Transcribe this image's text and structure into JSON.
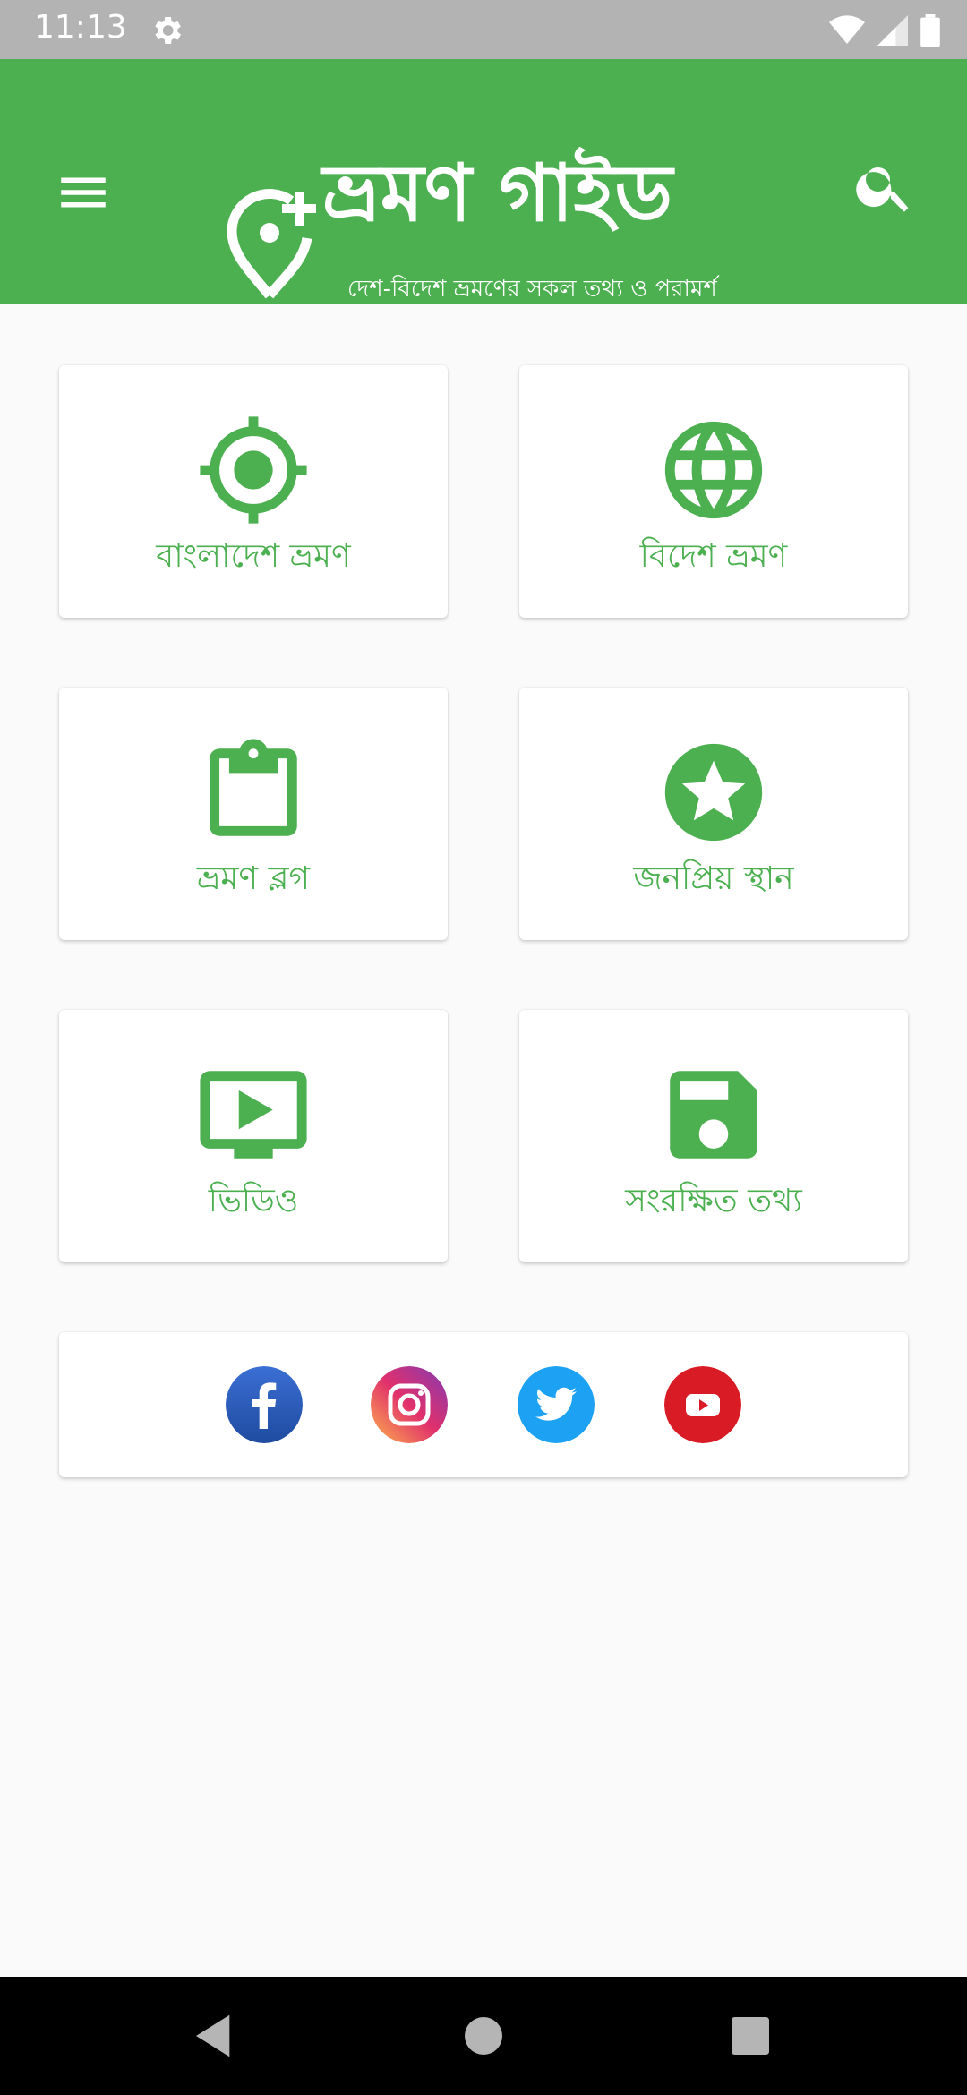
{
  "status_bar": {
    "time": "11:13",
    "icons": [
      "settings-icon",
      "wifi-icon",
      "signal-icon",
      "battery-icon"
    ]
  },
  "app_bar": {
    "title": "ভ্রমণ গাইড",
    "subtitle": "দেশ-বিদেশ ভ্রমণের সকল তথ্য ও পরামর্শ",
    "menu_icon": "menu-icon",
    "search_icon": "search-icon",
    "color": "#4caf50"
  },
  "menu": [
    {
      "label": "বাংলাদেশ ভ্রমণ",
      "icon": "location-target-icon"
    },
    {
      "label": "বিদেশ ভ্রমণ",
      "icon": "globe-icon"
    },
    {
      "label": "ভ্রমণ ব্লগ",
      "icon": "clipboard-icon"
    },
    {
      "label": "জনপ্রিয় স্থান",
      "icon": "star-icon"
    },
    {
      "label": "ভিডিও",
      "icon": "video-play-icon"
    },
    {
      "label": "সংরক্ষিত তথ্য",
      "icon": "save-icon"
    }
  ],
  "social": [
    "facebook-icon",
    "instagram-icon",
    "twitter-icon",
    "youtube-icon"
  ],
  "nav_bar": [
    "back-icon",
    "home-icon",
    "recents-icon"
  ],
  "colors": {
    "accent": "#4caf50",
    "background": "#fafafa"
  }
}
